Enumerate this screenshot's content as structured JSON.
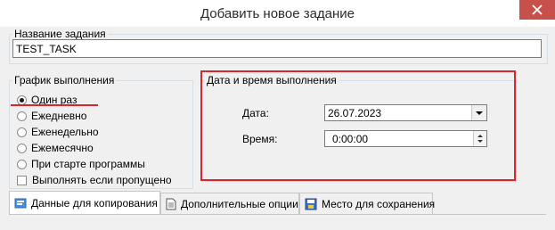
{
  "window": {
    "title": "Добавить новое задание"
  },
  "task_name": {
    "label": "Название задания",
    "value": "TEST_TASK"
  },
  "schedule": {
    "label": "График выполнения",
    "options": [
      {
        "label": "Один раз",
        "checked": true
      },
      {
        "label": "Ежедневно",
        "checked": false
      },
      {
        "label": "Еженедельно",
        "checked": false
      },
      {
        "label": "Ежемесячно",
        "checked": false
      },
      {
        "label": "При старте программы",
        "checked": false
      }
    ],
    "run_if_missed": {
      "label": "Выполнять если пропущено",
      "checked": false
    }
  },
  "datetime": {
    "label": "Дата и время выполнения",
    "date_label": "Дата:",
    "date_value": "26.07.2023",
    "time_label": "Время:",
    "time_value": "0:00:00"
  },
  "tabs": [
    {
      "label": "Данные для копирования",
      "icon": "data-icon",
      "active": true
    },
    {
      "label": "Дополнительные опции",
      "icon": "document-icon",
      "active": false
    },
    {
      "label": "Место для сохранения",
      "icon": "save-location-icon",
      "active": false
    }
  ],
  "colors": {
    "annotation": "#d9262e",
    "close_button": "#c7504b"
  }
}
